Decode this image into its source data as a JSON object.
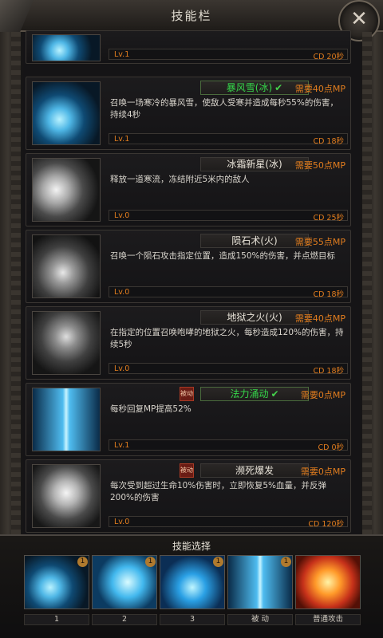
{
  "window": {
    "title": "技能栏",
    "close_label": "✕"
  },
  "skills": [
    {
      "name": "",
      "cost": "",
      "desc": "",
      "lv": "Lv.1",
      "cd": "CD 20秒",
      "passive": "",
      "active": false,
      "art": "art-ice"
    },
    {
      "name": "暴风雪(冰)",
      "cost": "需要40点MP",
      "desc": "召唤一场寒冷的暴风雪，使敌人受寒并造成每秒55%的伤害，持续4秒",
      "lv": "Lv.1",
      "cd": "CD 18秒",
      "passive": "",
      "active": true,
      "art": "art-ice"
    },
    {
      "name": "冰霜新星(冰)",
      "cost": "需要50点MP",
      "desc": "释放一道寒流，冻结附近5米内的敌人",
      "lv": "Lv.0",
      "cd": "CD 25秒",
      "passive": "",
      "active": false,
      "art": "art-crystal"
    },
    {
      "name": "陨石术(火)",
      "cost": "需要55点MP",
      "desc": "召唤一个陨石攻击指定位置，造成150%的伤害，并点燃目标",
      "lv": "Lv.0",
      "cd": "CD 18秒",
      "passive": "",
      "active": false,
      "art": "art-meteor"
    },
    {
      "name": "地狱之火(火)",
      "cost": "需要40点MP",
      "desc": "在指定的位置召唤咆哮的地狱之火，每秒造成120%的伤害，持续5秒",
      "lv": "Lv.0",
      "cd": "CD 18秒",
      "passive": "",
      "active": false,
      "art": "art-hell"
    },
    {
      "name": "法力涌动",
      "cost": "需要0点MP",
      "desc": "每秒回复MP提高52%",
      "lv": "Lv.1",
      "cd": "CD 0秒",
      "passive": "被动",
      "active": true,
      "art": "art-mana"
    },
    {
      "name": "濒死爆发",
      "cost": "需要0点MP",
      "desc": "每次受到超过生命10%伤害时，立即恢复5%血量，并反弹200%的伤害",
      "lv": "Lv.0",
      "cd": "CD 120秒",
      "passive": "被动",
      "active": false,
      "art": "art-burst"
    }
  ],
  "selection": {
    "title": "技能选择",
    "slots": [
      {
        "label": "1",
        "badge": "1",
        "art": "art-ice"
      },
      {
        "label": "2",
        "badge": "1",
        "art": "art-bolt"
      },
      {
        "label": "3",
        "badge": "1",
        "art": "art-swirl"
      },
      {
        "label": "被 动",
        "badge": "1",
        "art": "art-mana"
      },
      {
        "label": "普通攻击",
        "badge": "",
        "art": "art-fist"
      }
    ]
  },
  "colors": {
    "accent": "#e27d1e",
    "active_name": "#35d84a",
    "passive_badge": "#6a1c14"
  }
}
